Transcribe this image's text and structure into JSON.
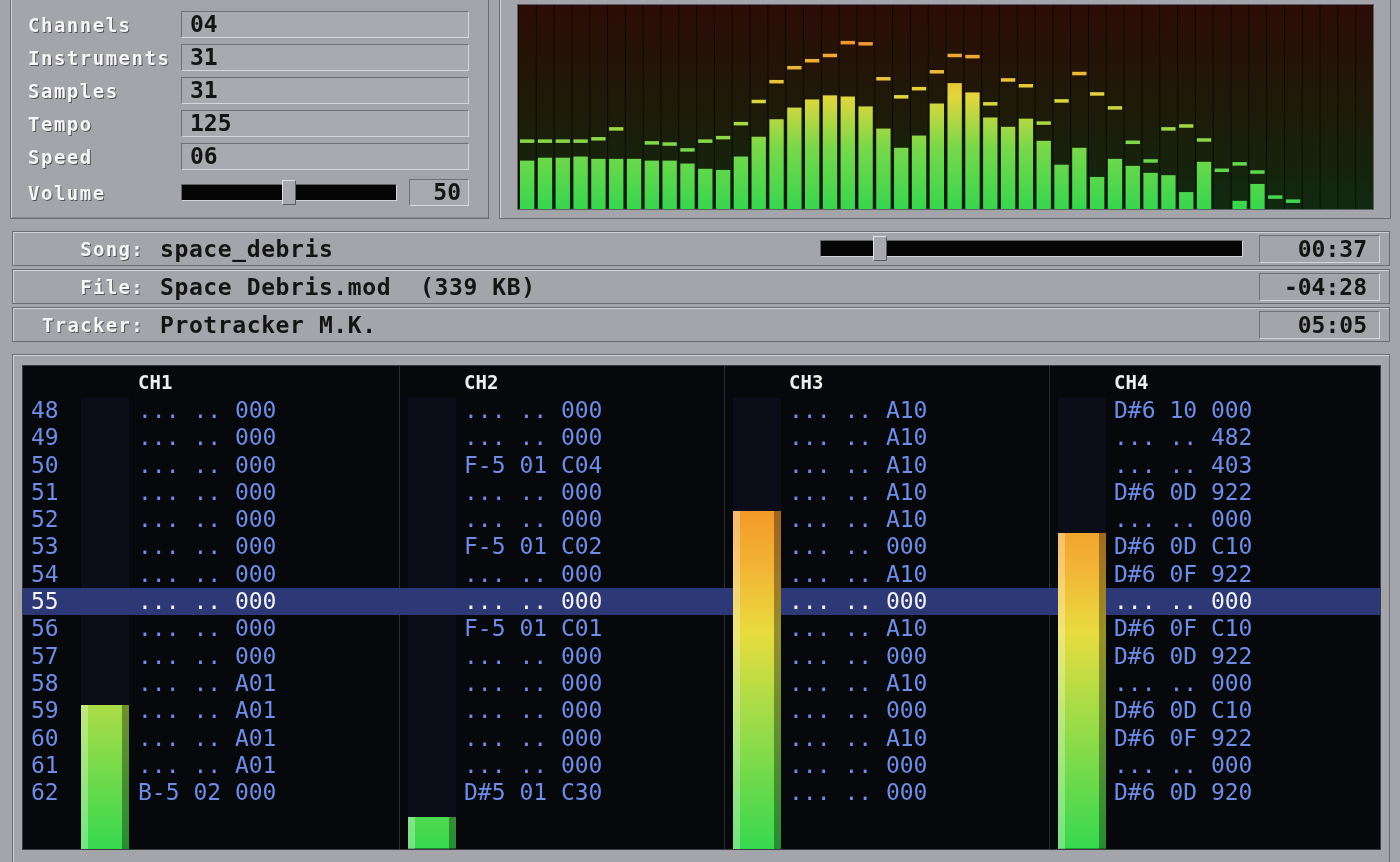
{
  "info_panel": {
    "fields": [
      {
        "label": "Channels",
        "value": "04"
      },
      {
        "label": "Instruments",
        "value": "31"
      },
      {
        "label": "Samples",
        "value": "31"
      },
      {
        "label": "Tempo",
        "value": "125"
      },
      {
        "label": "Speed",
        "value": "06"
      }
    ],
    "volume": {
      "label": "Volume",
      "level": 0.5,
      "value": "50"
    }
  },
  "song_info": [
    {
      "kind": "seek",
      "label": "Song:",
      "value": "space_debris",
      "level": 0.14,
      "time": "00:37"
    },
    {
      "kind": "plain",
      "label": "File:",
      "value": "Space Debris.mod  (339 KB)",
      "time": "-04:28"
    },
    {
      "kind": "plain",
      "label": "Tracker:",
      "value": "Protracker M.K.",
      "time": "05:05"
    }
  ],
  "pattern": {
    "channels": [
      {
        "name": "CH1",
        "level": 0.32
      },
      {
        "name": "CH2",
        "level": 0.07
      },
      {
        "name": "CH3",
        "level": 0.75
      },
      {
        "name": "CH4",
        "level": 0.7
      }
    ],
    "rows": [
      {
        "number": "48",
        "selected": false,
        "cells": [
          "... .. 000",
          "... .. 000",
          "... .. A10",
          "D#6 10 000"
        ]
      },
      {
        "number": "49",
        "selected": false,
        "cells": [
          "... .. 000",
          "... .. 000",
          "... .. A10",
          "... .. 482"
        ]
      },
      {
        "number": "50",
        "selected": false,
        "cells": [
          "... .. 000",
          "F-5 01 C04",
          "... .. A10",
          "... .. 403"
        ]
      },
      {
        "number": "51",
        "selected": false,
        "cells": [
          "... .. 000",
          "... .. 000",
          "... .. A10",
          "D#6 0D 922"
        ]
      },
      {
        "number": "52",
        "selected": false,
        "cells": [
          "... .. 000",
          "... .. 000",
          "... .. A10",
          "... .. 000"
        ]
      },
      {
        "number": "53",
        "selected": false,
        "cells": [
          "... .. 000",
          "F-5 01 C02",
          "... .. 000",
          "D#6 0D C10"
        ]
      },
      {
        "number": "54",
        "selected": false,
        "cells": [
          "... .. 000",
          "... .. 000",
          "... .. A10",
          "D#6 0F 922"
        ]
      },
      {
        "number": "55",
        "selected": true,
        "cells": [
          "... .. 000",
          "... .. 000",
          "... .. 000",
          "... .. 000"
        ]
      },
      {
        "number": "56",
        "selected": false,
        "cells": [
          "... .. 000",
          "F-5 01 C01",
          "... .. A10",
          "D#6 0F C10"
        ]
      },
      {
        "number": "57",
        "selected": false,
        "cells": [
          "... .. 000",
          "... .. 000",
          "... .. 000",
          "D#6 0D 922"
        ]
      },
      {
        "number": "58",
        "selected": false,
        "cells": [
          "... .. A01",
          "... .. 000",
          "... .. A10",
          "... .. 000"
        ]
      },
      {
        "number": "59",
        "selected": false,
        "cells": [
          "... .. A01",
          "... .. 000",
          "... .. 000",
          "D#6 0D C10"
        ]
      },
      {
        "number": "60",
        "selected": false,
        "cells": [
          "... .. A01",
          "... .. 000",
          "... .. A10",
          "D#6 0F 922"
        ]
      },
      {
        "number": "61",
        "selected": false,
        "cells": [
          "... .. A01",
          "... .. 000",
          "... .. 000",
          "... .. 000"
        ]
      },
      {
        "number": "62",
        "selected": false,
        "cells": [
          "B-5 02 000",
          "D#5 01 C30",
          "... .. 000",
          "D#6 0D 920"
        ]
      }
    ]
  }
}
